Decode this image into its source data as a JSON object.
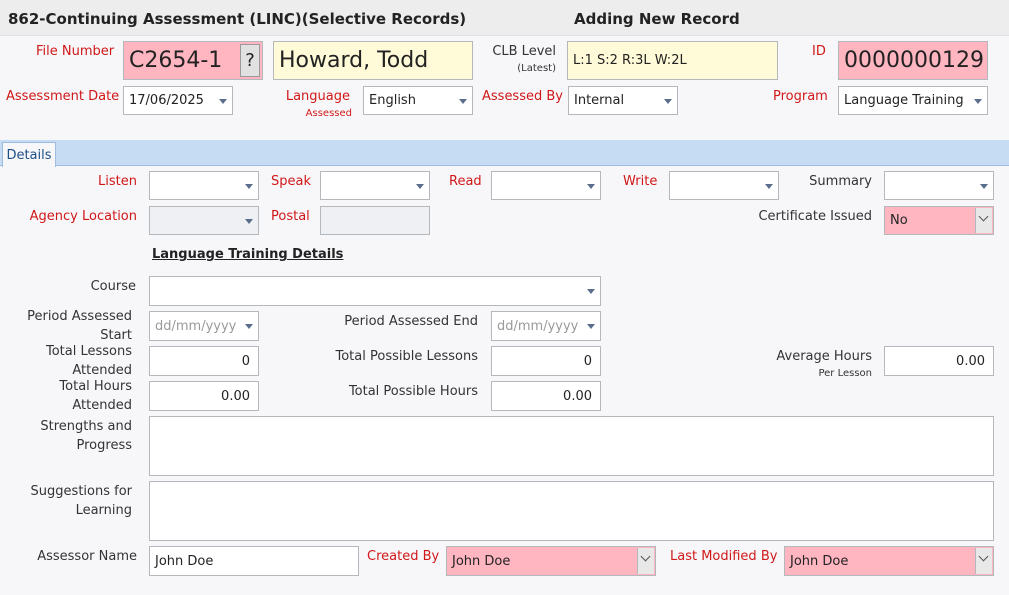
{
  "header": {
    "form_title": "862-Continuing Assessment (LINC)(Selective Records)",
    "mode": "Adding New Record"
  },
  "top": {
    "file_number": {
      "label": "File Number",
      "value": "C2654-1",
      "lookup": "?"
    },
    "client_name": "Howard, Todd",
    "clb_level": {
      "label": "CLB Level",
      "sublabel": "(Latest)",
      "value": "L:1 S:2 R:3L W:2L"
    },
    "id": {
      "label": "ID",
      "value": "0000000129"
    },
    "assessment_date": {
      "label": "Assessment Date",
      "value": "17/06/2025"
    },
    "language": {
      "label": "Language",
      "sublabel": "Assessed",
      "value": "English"
    },
    "assessed_by": {
      "label": "Assessed By",
      "value": "Internal"
    },
    "program": {
      "label": "Program",
      "value": "Language Training"
    }
  },
  "tabs": [
    {
      "label": "Details"
    }
  ],
  "details": {
    "listen": {
      "label": "Listen",
      "value": ""
    },
    "speak": {
      "label": "Speak",
      "value": ""
    },
    "read": {
      "label": "Read",
      "value": ""
    },
    "write": {
      "label": "Write",
      "value": ""
    },
    "summary": {
      "label": "Summary",
      "value": ""
    },
    "agency_location": {
      "label": "Agency Location",
      "value": ""
    },
    "postal": {
      "label": "Postal",
      "value": ""
    },
    "certificate_issued": {
      "label": "Certificate Issued",
      "value": "No"
    },
    "section_title": "Language Training Details",
    "course": {
      "label": "Course",
      "value": ""
    },
    "period_start": {
      "label_line1": "Period Assessed",
      "label_line2": "Start",
      "placeholder": "dd/mm/yyyy"
    },
    "period_end": {
      "label": "Period Assessed End",
      "placeholder": "dd/mm/yyyy"
    },
    "total_lessons_attended": {
      "label_line1": "Total Lessons",
      "label_line2": "Attended",
      "value": "0"
    },
    "total_possible_lessons": {
      "label": "Total Possible Lessons",
      "value": "0"
    },
    "average_hours": {
      "label": "Average Hours",
      "sublabel": "Per Lesson",
      "value": "0.00"
    },
    "total_hours_attended": {
      "label_line1": "Total Hours",
      "label_line2": "Attended",
      "value": "0.00"
    },
    "total_possible_hours": {
      "label": "Total Possible Hours",
      "value": "0.00"
    },
    "strengths": {
      "label_line1": "Strengths and",
      "label_line2": "Progress",
      "value": ""
    },
    "suggestions": {
      "label_line1": "Suggestions for",
      "label_line2": "Learning",
      "value": ""
    },
    "assessor_name": {
      "label": "Assessor Name",
      "value": "John Doe"
    },
    "created_by": {
      "label": "Created By",
      "value": "John Doe"
    },
    "last_modified_by": {
      "label": "Last Modified By",
      "value": "John Doe"
    }
  }
}
